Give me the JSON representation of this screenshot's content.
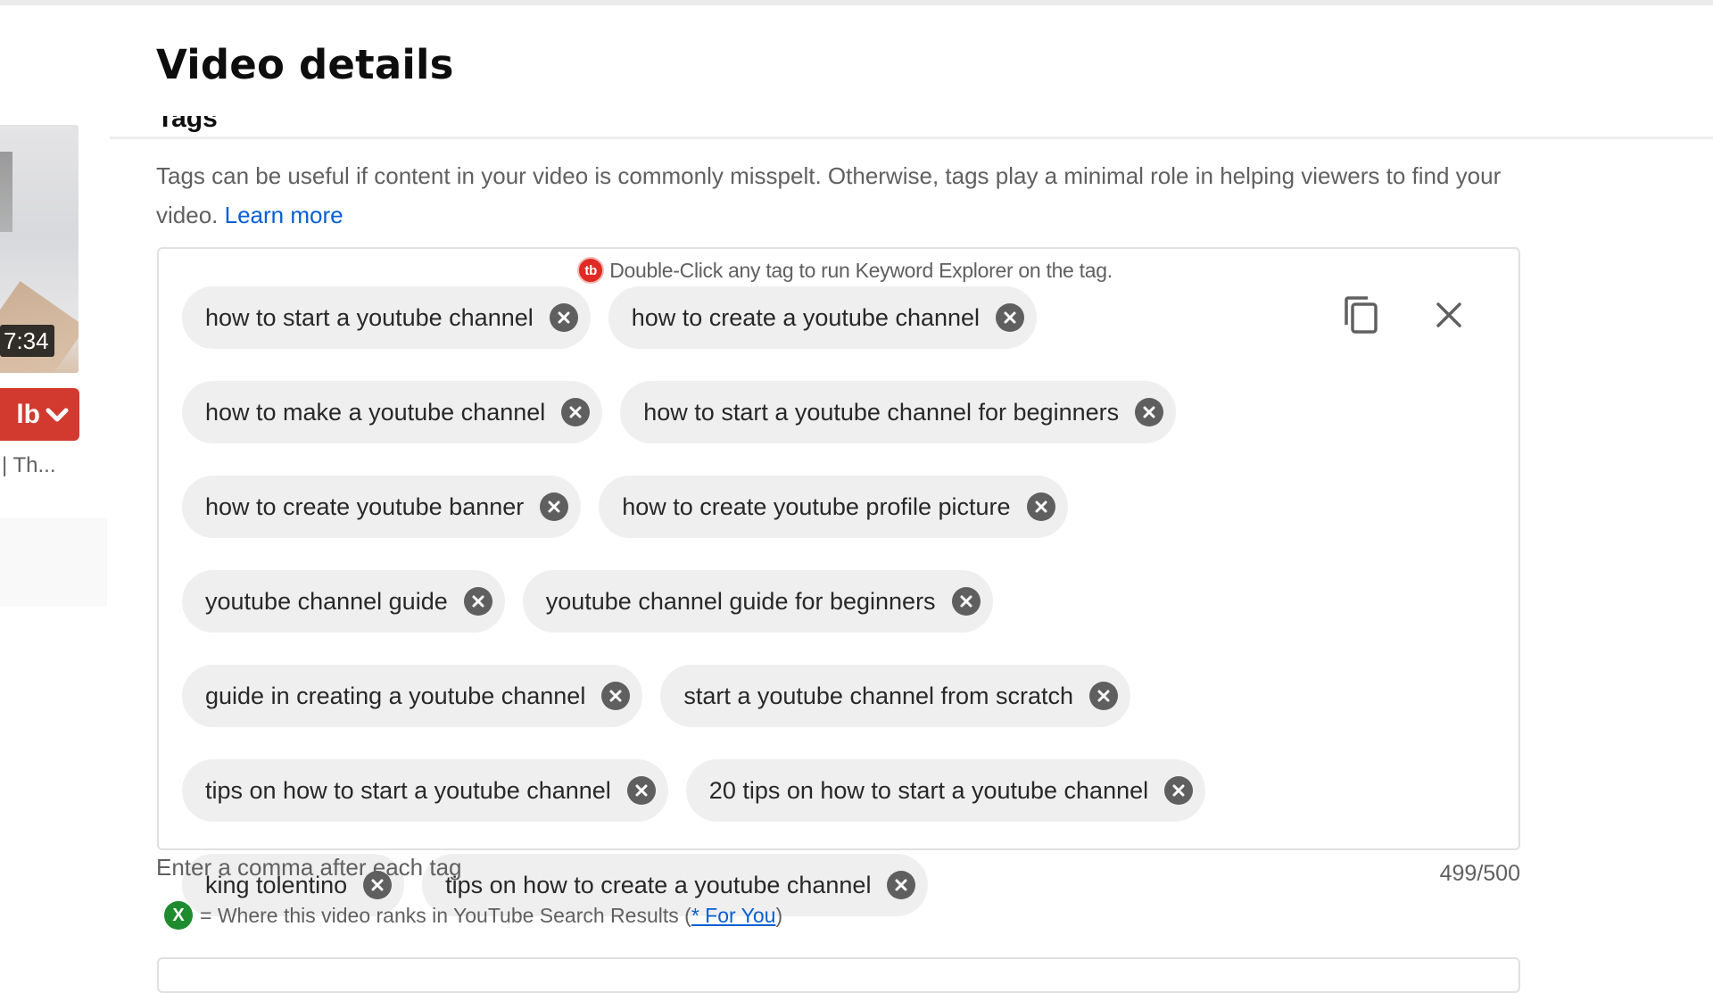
{
  "header": {
    "title": "Video details"
  },
  "sidebar": {
    "thumbnail_duration": "7:34",
    "tubebuddy_button_label": "lb",
    "video_title_snippet": "| Th..."
  },
  "tags_section": {
    "heading": "Tags",
    "description": "Tags can be useful if content in your video is commonly misspelt. Otherwise, tags play a minimal role in helping viewers to find your video.",
    "learn_more_label": "Learn more",
    "hint_logo": "tb",
    "hint_text": "Double-Click any tag to run Keyword Explorer on the tag.",
    "tags": [
      "how to start a youtube channel",
      "how to create a youtube channel",
      "how to make a youtube channel",
      "how to start a youtube channel for beginners",
      "how to create youtube banner",
      "how to create youtube profile picture",
      "youtube channel guide",
      "youtube channel guide for beginners",
      "guide in creating a youtube channel",
      "start a youtube channel from scratch",
      "tips on how to start a youtube channel",
      "20 tips on how to start a youtube channel",
      "king tolentino",
      "tips on how to create a youtube channel"
    ],
    "rows": [
      [
        0,
        1
      ],
      [
        2,
        3
      ],
      [
        4,
        5
      ],
      [
        6,
        7
      ],
      [
        8,
        9
      ],
      [
        10,
        11
      ],
      [
        12,
        13
      ]
    ],
    "copy_icon": "copy-icon",
    "clear_icon": "close-icon",
    "helper_text": "Enter a comma after each tag",
    "char_count": "499/500",
    "rank_badge": "X",
    "rank_text": "= Where this video ranks in YouTube Search Results (",
    "rank_link": "* For You",
    "rank_close": ")"
  },
  "colors": {
    "tubebuddy_red": "#d23a2f",
    "link_blue": "#065fd4",
    "rank_green": "#1e8c2e",
    "chip_bg": "#efefef"
  }
}
